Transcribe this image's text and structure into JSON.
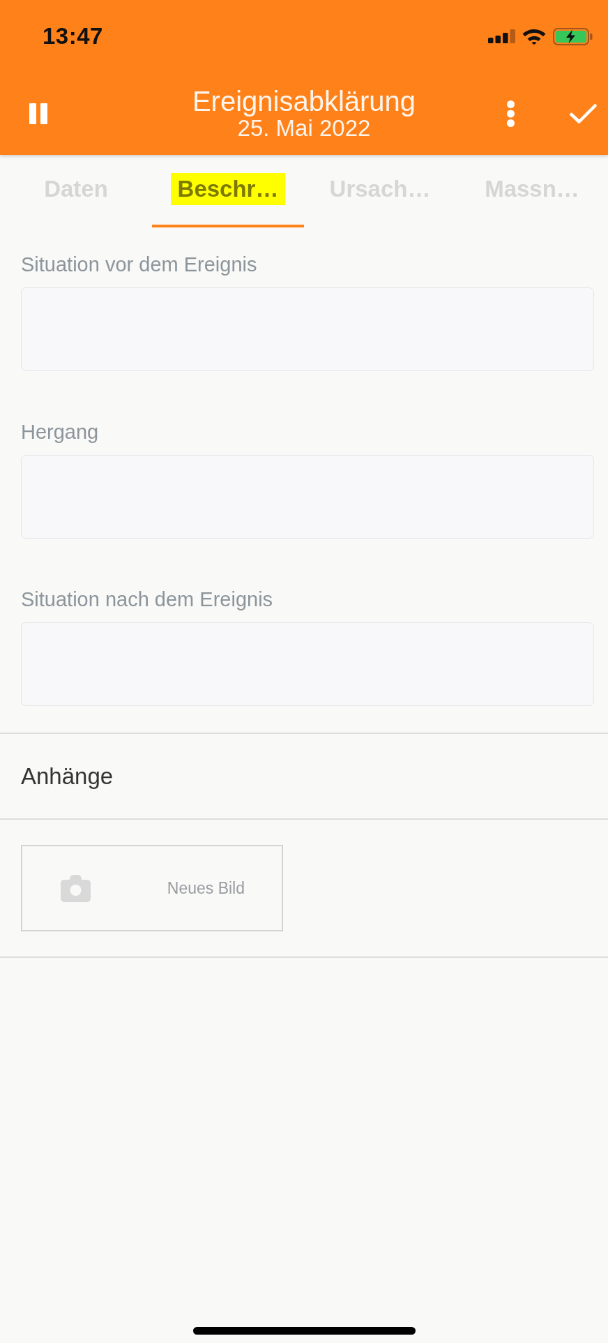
{
  "status_bar": {
    "time": "13:47"
  },
  "header": {
    "title": "Ereignisabklärung",
    "subtitle": "25. Mai 2022"
  },
  "tabs": [
    {
      "label": "Daten",
      "selected": false
    },
    {
      "label": "Beschr…",
      "selected": true
    },
    {
      "label": "Ursach…",
      "selected": false
    },
    {
      "label": "Massn…",
      "selected": false
    }
  ],
  "fields": [
    {
      "label": "Situation vor dem Ereignis"
    },
    {
      "label": "Hergang"
    },
    {
      "label": "Situation nach dem Ereignis"
    }
  ],
  "attachments": {
    "title": "Anhänge",
    "new_image_button": "Neues Bild"
  }
}
